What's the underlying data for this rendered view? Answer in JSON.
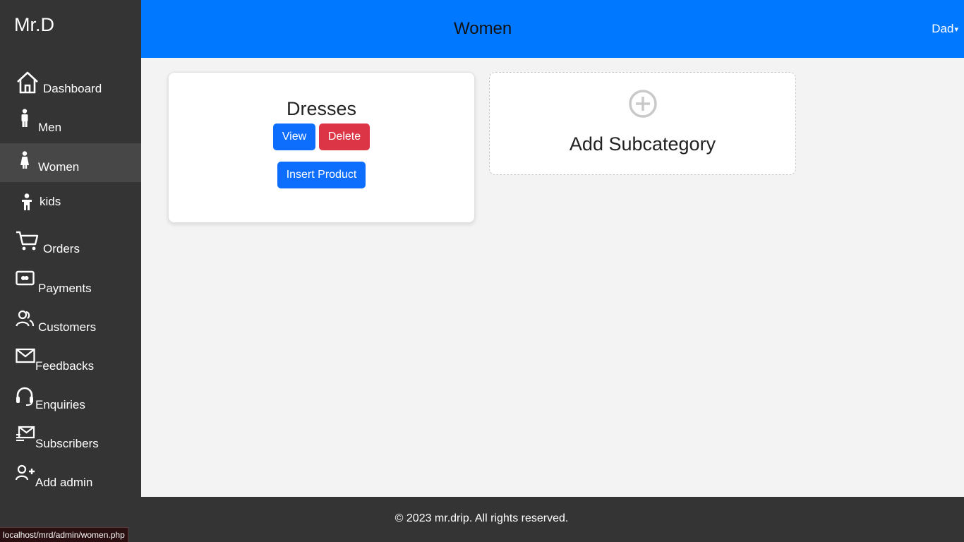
{
  "brand": "Mr.D",
  "header": {
    "title": "Women",
    "user": "Dad",
    "caret": "▾"
  },
  "sidebar": {
    "items": [
      {
        "label": "Dashboard",
        "icon": "home-icon"
      },
      {
        "label": "Men",
        "icon": "man-icon"
      },
      {
        "label": "Women",
        "icon": "woman-icon",
        "active": true
      },
      {
        "label": "kids",
        "icon": "child-icon"
      },
      {
        "label": "Orders",
        "icon": "cart-icon"
      },
      {
        "label": "Payments",
        "icon": "payment-icon"
      },
      {
        "label": "Customers",
        "icon": "users-icon"
      },
      {
        "label": "Feedbacks",
        "icon": "envelope-icon"
      },
      {
        "label": "Enquiries",
        "icon": "headset-icon"
      },
      {
        "label": "Subscribers",
        "icon": "subscribe-icon"
      },
      {
        "label": "Add admin",
        "icon": "user-plus-icon"
      }
    ]
  },
  "main": {
    "subcategory": {
      "title": "Dresses",
      "view_label": "View",
      "delete_label": "Delete",
      "insert_label": "Insert Product"
    },
    "add_card": {
      "label": "Add Subcategory",
      "icon": "plus-circle-icon"
    }
  },
  "footer": {
    "text": "© 2023 mr.drip. All rights reserved."
  },
  "status_bar": {
    "url": "localhost/mrd/admin/women.php"
  },
  "colors": {
    "sidebar_bg": "#343434",
    "active_bg": "#474747",
    "header_bg": "#0078ff",
    "primary": "#0d6efd",
    "danger": "#dc3545",
    "page_bg": "#f3f3f3"
  }
}
